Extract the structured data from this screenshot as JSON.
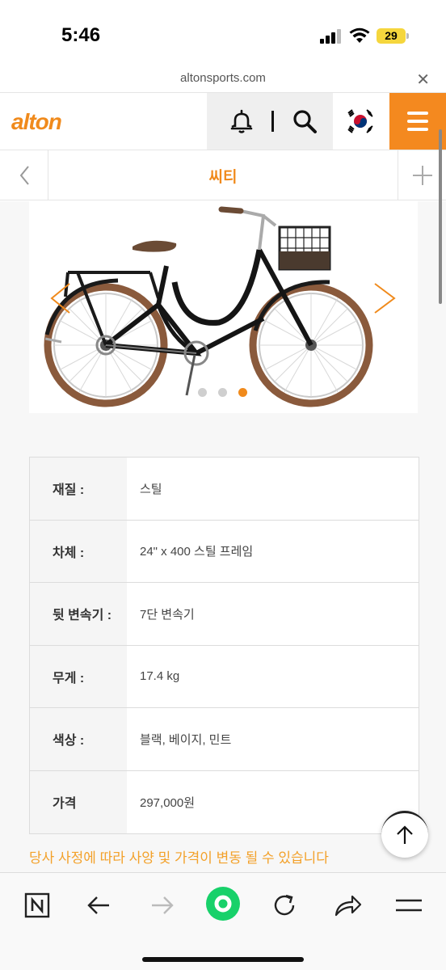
{
  "status": {
    "time": "5:46",
    "battery": "29"
  },
  "browser": {
    "url": "altonsports.com"
  },
  "header": {
    "logo": "alton"
  },
  "subnav": {
    "title": "씨티"
  },
  "specs": [
    {
      "label": "재질 :",
      "value": "스틸"
    },
    {
      "label": "차체 :",
      "value": "24\" x 400 스틸 프레임"
    },
    {
      "label": "뒷 변속기 :",
      "value": "7단 변속기"
    },
    {
      "label": "무게 :",
      "value": "17.4 kg"
    },
    {
      "label": "색상 :",
      "value": "블랙, 베이지, 민트"
    },
    {
      "label": "가격",
      "value": "297,000원"
    }
  ],
  "notice": "당사 사정에 따라 사양 및 가격이 변동 될 수 있습니다",
  "slider": {
    "total": 3,
    "active": 3
  },
  "colors": {
    "brand": "#f08a1c",
    "menu": "#f4891f",
    "notice": "#f3a12a"
  },
  "icons": [
    "bell-icon",
    "search-icon",
    "korea-flag-icon",
    "hamburger-menu-icon",
    "chevron-left-icon",
    "plus-icon",
    "arrow-up-icon",
    "n-logo-icon",
    "back-arrow-icon",
    "forward-arrow-icon",
    "home-circle-icon",
    "reload-icon",
    "share-icon",
    "tabs-menu-icon"
  ]
}
